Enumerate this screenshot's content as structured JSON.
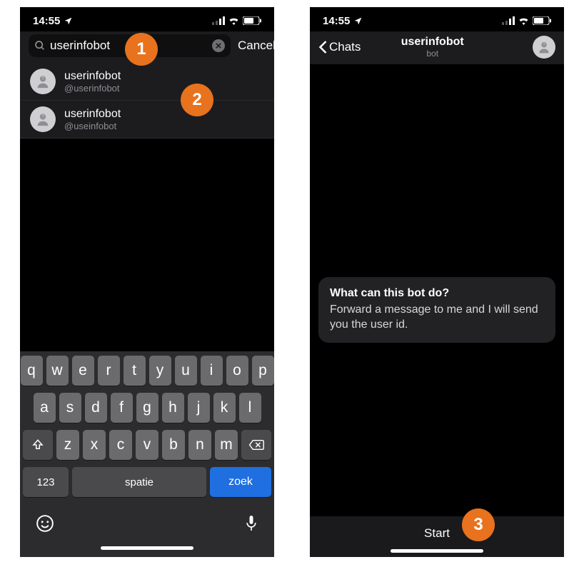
{
  "status": {
    "time": "14:55",
    "location_icon": "location-arrow"
  },
  "screen1": {
    "search_value": "userinfobot",
    "cancel_label": "Cancel",
    "results": [
      {
        "name": "userinfobot",
        "handle": "@userinfobot"
      },
      {
        "name": "userinfobot",
        "handle": "@useinfobot"
      }
    ]
  },
  "keyboard": {
    "row1": [
      "q",
      "w",
      "e",
      "r",
      "t",
      "y",
      "u",
      "i",
      "o",
      "p"
    ],
    "row2": [
      "a",
      "s",
      "d",
      "f",
      "g",
      "h",
      "j",
      "k",
      "l"
    ],
    "row3": [
      "z",
      "x",
      "c",
      "v",
      "b",
      "n",
      "m"
    ],
    "num_label": "123",
    "space_label": "spatie",
    "action_label": "zoek"
  },
  "screen2": {
    "back_label": "Chats",
    "title": "userinfobot",
    "subtitle": "bot",
    "bubble_title": "What can this bot do?",
    "bubble_body": "Forward a message to me and I will send you the user id.",
    "start_label": "Start"
  },
  "badges": {
    "b1": "1",
    "b2": "2",
    "b3": "3"
  }
}
